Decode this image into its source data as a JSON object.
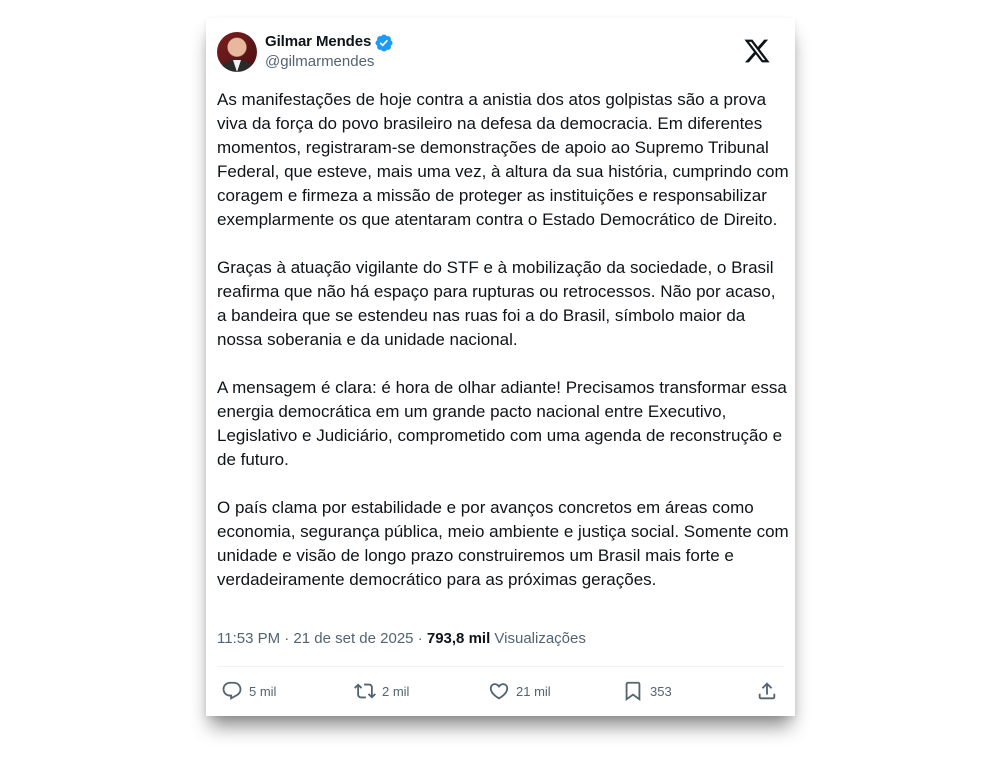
{
  "author": {
    "name": "Gilmar Mendes",
    "handle": "@gilmarmendes",
    "verified_color": "#1d9bf0"
  },
  "platform_icon": "x-logo-icon",
  "post": {
    "paragraphs": [
      "As manifestações de hoje contra a anistia dos atos golpistas são a prova viva da força do povo brasileiro na defesa da democracia. Em diferentes momentos, registraram-se demonstrações de apoio ao Supremo Tribunal Federal, que esteve, mais uma vez, à altura da sua história, cumprindo com coragem e firmeza a missão de proteger as instituições e responsabilizar exemplarmente os que atentaram contra o Estado Democrático de Direito.",
      "Graças à atuação vigilante do STF e à mobilização da sociedade, o Brasil reafirma que não há espaço para rupturas ou retrocessos. Não por acaso, a bandeira que se estendeu nas ruas foi a do Brasil, símbolo maior da nossa soberania e da unidade nacional.",
      "A mensagem é clara: é hora de olhar adiante! Precisamos transformar essa energia democrática em um grande pacto nacional entre Executivo, Legislativo e Judiciário, comprometido com uma agenda de reconstrução e de futuro.",
      "O país clama por estabilidade e por avanços concretos em áreas como economia, segurança pública, meio ambiente e justiça social. Somente com unidade e visão de longo prazo construiremos um Brasil mais forte e verdadeiramente democrático para as próximas gerações."
    ]
  },
  "meta": {
    "timestamp": "11:53 PM · 21 de set de 2025 · ",
    "views_count": "793,8 mil",
    "views_label": " Visualizações"
  },
  "actions": {
    "replies": {
      "icon": "reply-icon",
      "count": "5 mil"
    },
    "reposts": {
      "icon": "repost-icon",
      "count": "2 mil"
    },
    "likes": {
      "icon": "like-icon",
      "count": "21 mil"
    },
    "bookmarks": {
      "icon": "bookmark-icon",
      "count": "353"
    },
    "share": {
      "icon": "share-icon"
    }
  }
}
